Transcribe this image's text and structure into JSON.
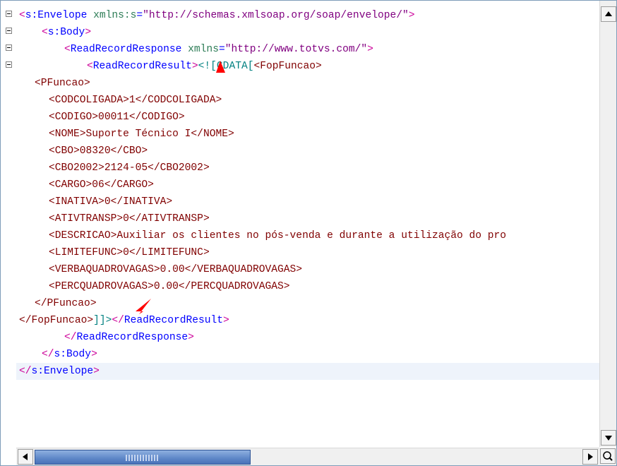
{
  "lines": [
    {
      "parts": [
        "<",
        "s:Envelope",
        " xmlns:s",
        "=",
        "\"http://schemas.xmlsoap.org/soap/envelope/\"",
        ">"
      ]
    },
    {
      "parts": [
        "<",
        "s:Body",
        ">"
      ]
    },
    {
      "parts": [
        "<",
        "ReadRecordResponse",
        " xmlns",
        "=",
        "\"http://www.totvs.com/\"",
        ">"
      ]
    },
    {
      "parts": [
        "<",
        "ReadRecordResult",
        ">",
        "<![CDATA[",
        "<FopFuncao>"
      ]
    },
    {
      "text": "<PFuncao>"
    },
    {
      "text": "<CODCOLIGADA>1</CODCOLIGADA>"
    },
    {
      "text": "<CODIGO>00011</CODIGO>"
    },
    {
      "text": "<NOME>Suporte Técnico I</NOME>"
    },
    {
      "text": "<CBO>08320</CBO>"
    },
    {
      "text": "<CBO2002>2124-05</CBO2002>"
    },
    {
      "text": "<CARGO>06</CARGO>"
    },
    {
      "text": "<INATIVA>0</INATIVA>"
    },
    {
      "text": "<ATIVTRANSP>0</ATIVTRANSP>"
    },
    {
      "text": "<DESCRICAO>Auxiliar os clientes no pós-venda e durante a utilização do pro"
    },
    {
      "text": "<LIMITEFUNC>0</LIMITEFUNC>"
    },
    {
      "text": "<VERBAQUADROVAGAS>0.00</VERBAQUADROVAGAS>"
    },
    {
      "text": "<PERCQUADROVAGAS>0.00</PERCQUADROVAGAS>"
    },
    {
      "text": "</PFuncao>"
    },
    {
      "parts": [
        "</FopFuncao>",
        "]]>",
        "</",
        "ReadRecordResult",
        ">"
      ]
    },
    {
      "parts": [
        "</",
        "ReadRecordResponse",
        ">"
      ]
    },
    {
      "parts": [
        "</",
        "s:Body",
        ">"
      ]
    },
    {
      "parts": [
        "</",
        "s:Envelope",
        ">"
      ]
    }
  ],
  "colors": {
    "tag": "#800000",
    "element": "#0000ff",
    "bracket": "#cc0099",
    "attr": "#2e7d57",
    "value": "#800080",
    "cdata": "#008080",
    "arrow": "#ff0000",
    "highlight": "#eef3fb"
  },
  "icons": [
    "fold-minus-icon",
    "scroll-up-arrow-icon",
    "scroll-down-arrow-icon",
    "scroll-left-arrow-icon",
    "scroll-right-arrow-icon",
    "zoom-icon"
  ]
}
